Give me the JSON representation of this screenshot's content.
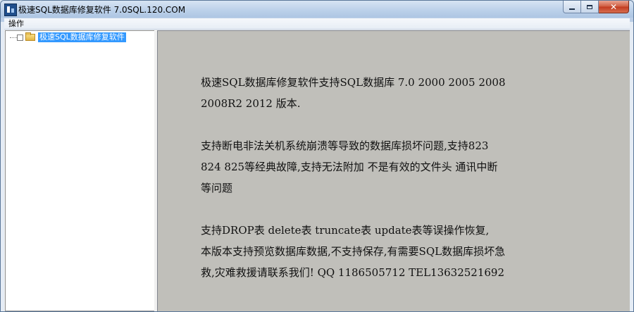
{
  "window": {
    "title": "极速SQL数据库修复软件 7.0SQL.120.COM",
    "controls": {
      "minimize": "",
      "maximize": "",
      "close": "✕"
    }
  },
  "menu": {
    "items": [
      {
        "label": "操作"
      }
    ]
  },
  "tree": {
    "root": {
      "label": "极速SQL数据库修复软件",
      "icon": "folder-icon",
      "selected": true
    }
  },
  "content": {
    "paragraphs": [
      {
        "lines": [
          "极速SQL数据库修复软件支持SQL数据库 7.0 2000 2005 2008",
          "2008R2 2012 版本."
        ]
      },
      {
        "lines": [
          "支持断电非法关机系统崩溃等导致的数据库损坏问题,支持823",
          "824 825等经典故障,支持无法附加 不是有效的文件头 通讯中断",
          "等问题"
        ]
      },
      {
        "lines": [
          "支持DROP表 delete表 truncate表 update表等误操作恢复,",
          "本版本支持预览数据库数据,不支持保存,有需要SQL数据库损坏急",
          "救,灾难救援请联系我们! QQ 1186505712 TEL13632521692"
        ]
      }
    ]
  },
  "colors": {
    "content_bg": "#c0bfba",
    "selection": "#3399ff",
    "titlebar": "#bcd1ea"
  }
}
